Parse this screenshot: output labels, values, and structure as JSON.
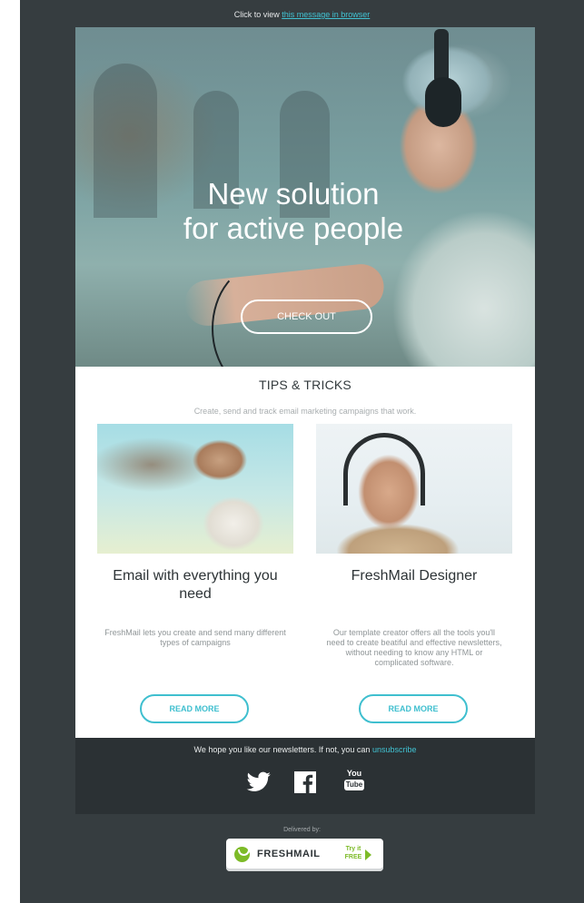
{
  "preheader": {
    "text": "Click to view",
    "link": "this message in browser"
  },
  "hero": {
    "line1": "New solution",
    "line2": "for active people",
    "button": "CHECK OUT"
  },
  "section": {
    "title": "TIPS & TRICKS",
    "subtitle": "Create, send and track email marketing campaigns that work."
  },
  "cards": [
    {
      "title": "Email with everything you need",
      "desc": "FreshMail lets you create and send many different types of campaigns",
      "button": "READ MORE"
    },
    {
      "title": "FreshMail Designer",
      "desc": "Our template creator offers all the tools you'll need to create beatiful and effective newsletters, without needing to know any HTML or complicated software.",
      "button": "READ MORE"
    }
  ],
  "footer": {
    "note": "We hope you like our newsletters. If not, you can",
    "unsubscribe": "unsubscribe",
    "social": [
      "twitter-icon",
      "facebook-icon",
      "youtube-icon"
    ],
    "youtube_top": "You",
    "youtube_bottom": "Tube"
  },
  "delivered": {
    "label": "Delivered by:",
    "brand": "FRESHMAIL",
    "try_line1": "Try it",
    "try_line2": "FREE"
  },
  "colors": {
    "frame": "#363d40",
    "accent": "#41c3d3",
    "brand_green": "#7dbb28"
  }
}
